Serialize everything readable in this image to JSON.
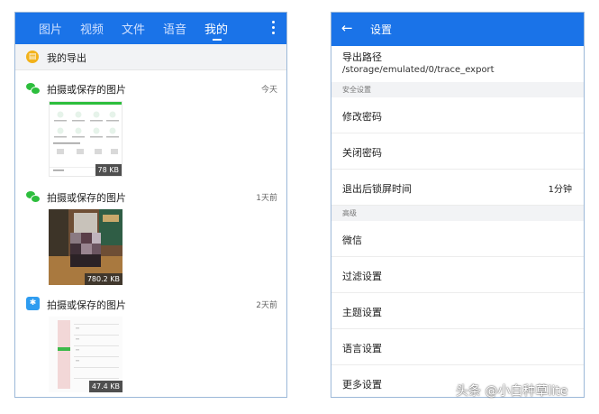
{
  "left": {
    "tabs": [
      "图片",
      "视频",
      "文件",
      "语音",
      "我的"
    ],
    "active_tab": "我的",
    "export_label": "我的导出",
    "groups": [
      {
        "title": "拍摄或保存的图片",
        "time": "今天",
        "size": "78 KB",
        "icon": "wechat-icon"
      },
      {
        "title": "拍摄或保存的图片",
        "time": "1天前",
        "size": "780.2 KB",
        "icon": "wechat-icon"
      },
      {
        "title": "拍摄或保存的图片",
        "time": "2天前",
        "size": "47.4 KB",
        "icon": "app-icon"
      }
    ]
  },
  "right": {
    "title": "设置",
    "export_path": {
      "title": "导出路径",
      "value": "/storage/emulated/0/trace_export"
    },
    "section_security": "安全设置",
    "rows_security": [
      {
        "label": "修改密码",
        "value": ""
      },
      {
        "label": "关闭密码",
        "value": ""
      },
      {
        "label": "退出后锁屏时间",
        "value": "1分钟"
      }
    ],
    "section_advanced": "高级",
    "rows_advanced": [
      "微信",
      "过滤设置",
      "主题设置",
      "语言设置",
      "更多设置"
    ]
  },
  "watermark": "头条 @小白种草lite",
  "colors": {
    "primary": "#1a73e8",
    "section_bg": "#f2f3f5",
    "export_icon": "#f2b21b",
    "wechat": "#2dbe3d"
  }
}
